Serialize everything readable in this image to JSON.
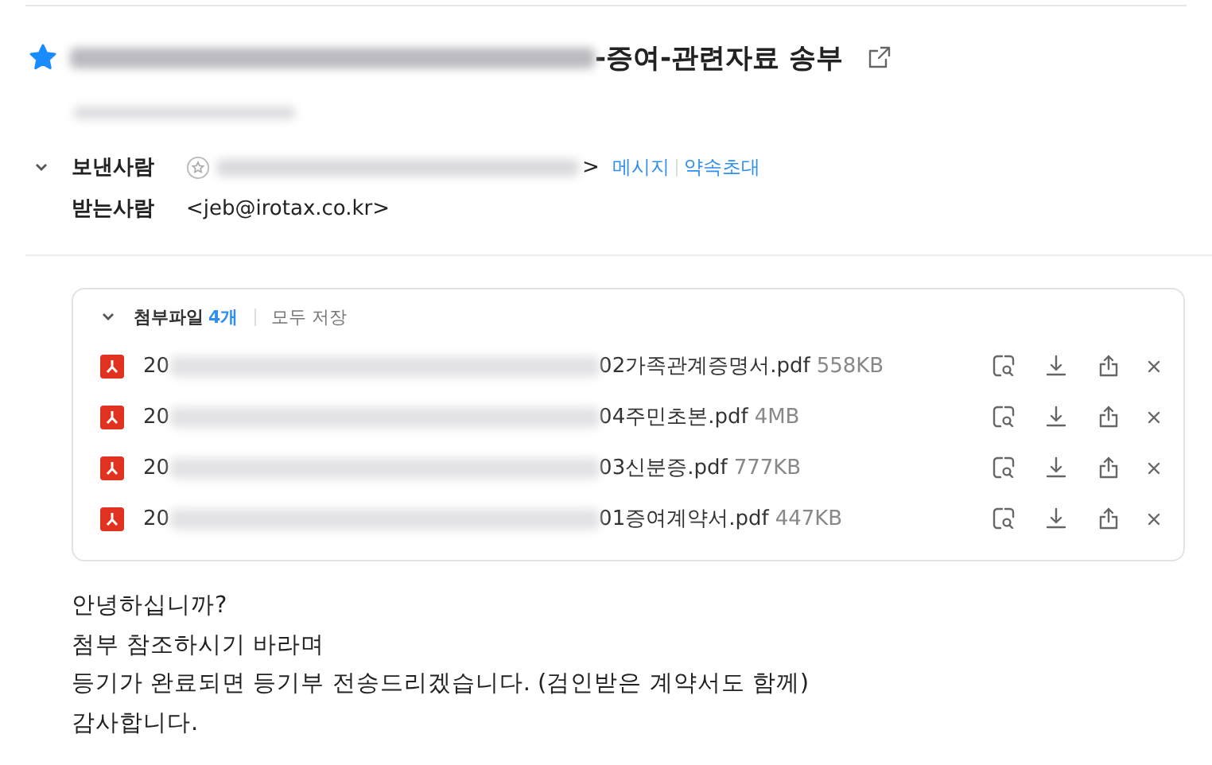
{
  "subject": {
    "starred": true,
    "title_tail": "-증여-관련자료 송부"
  },
  "sender": {
    "label": "보낸사람",
    "address_tail": ">",
    "links": [
      "메시지",
      "약속초대"
    ]
  },
  "recipient": {
    "label": "받는사람",
    "address": "<jeb@irotax.co.kr>"
  },
  "attachments": {
    "expanded": true,
    "label": "첨부파일",
    "count": "4개",
    "save_all": "모두 저장",
    "files": [
      {
        "prefix": "20",
        "name": "02가족관계증명서.pdf",
        "size": "558KB"
      },
      {
        "prefix": "20",
        "name": "04주민초본.pdf",
        "size": "4MB"
      },
      {
        "prefix": "20",
        "name": "03신분증.pdf",
        "size": "777KB"
      },
      {
        "prefix": "20",
        "name": "01증여계약서.pdf",
        "size": "447KB"
      }
    ]
  },
  "body": [
    "안녕하십니까?",
    "첨부 참조하시기 바라며",
    "등기가 완료되면 등기부 전송드리겠습니다. (검인받은 계약서도 함께)",
    "감사합니다."
  ]
}
